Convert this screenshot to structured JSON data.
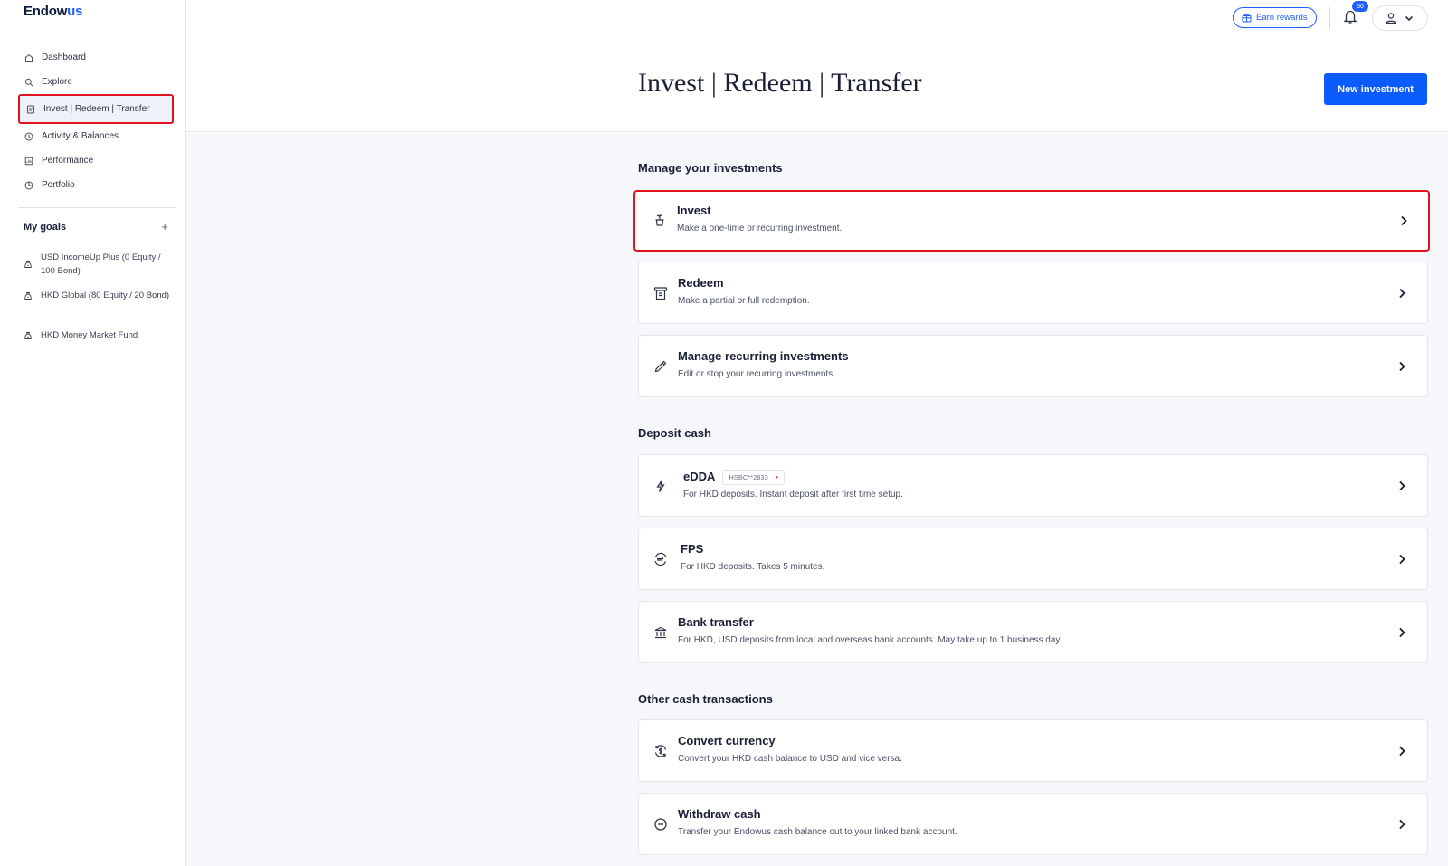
{
  "sidebar": {
    "logo_main": "Endow",
    "logo_accent": "us",
    "nav": [
      {
        "label": "Dashboard",
        "icon": "home-icon"
      },
      {
        "label": "Explore",
        "icon": "search-icon"
      },
      {
        "label": "Invest | Redeem | Transfer",
        "icon": "document-icon",
        "active": true
      },
      {
        "label": "Activity & Balances",
        "icon": "clock-icon"
      },
      {
        "label": "Performance",
        "icon": "chart-icon"
      },
      {
        "label": "Portfolio",
        "icon": "pie-icon"
      }
    ],
    "goals_title": "My goals",
    "goals_add": "+",
    "goals": [
      {
        "label": "USD IncomeUp Plus (0 Equity / 100 Bond)"
      },
      {
        "label": "HKD Global (80 Equity / 20 Bond)"
      },
      {
        "label": "HKD Money Market Fund"
      }
    ]
  },
  "header": {
    "earn_rewards": "Earn rewards",
    "notification_count": "50",
    "title": "Invest | Redeem | Transfer",
    "new_investment": "New investment"
  },
  "sections": {
    "manage": {
      "title": "Manage your investments",
      "cards": [
        {
          "title": "Invest",
          "desc": "Make a one-time or recurring investment.",
          "icon": "plant-pot-icon"
        },
        {
          "title": "Redeem",
          "desc": "Make a partial or full redemption.",
          "icon": "receipt-icon"
        },
        {
          "title": "Manage recurring investments",
          "desc": "Edit or stop your recurring investments.",
          "icon": "pencil-icon"
        }
      ]
    },
    "deposit": {
      "title": "Deposit cash",
      "cards": [
        {
          "title": "eDDA",
          "tag": "HSBC**2833",
          "desc": "For HKD deposits. Instant deposit after first time setup.",
          "icon": "lightning-icon"
        },
        {
          "title": "FPS",
          "desc": "For HKD deposits. Takes 5 minutes.",
          "icon": "fps-icon"
        },
        {
          "title": "Bank transfer",
          "desc": "For HKD, USD deposits from local and overseas bank accounts. May take up to 1 business day.",
          "icon": "bank-icon"
        }
      ]
    },
    "other": {
      "title": "Other cash transactions",
      "cards": [
        {
          "title": "Convert currency",
          "desc": "Convert your HKD cash balance to USD and vice versa.",
          "icon": "currency-exchange-icon"
        },
        {
          "title": "Withdraw cash",
          "desc": "Transfer your Endowus cash balance out to your linked bank account.",
          "icon": "minus-circle-icon"
        }
      ]
    }
  },
  "colors": {
    "brand_blue": "#0a5cff",
    "highlight_red": "#e0141e",
    "background": "#f5f7fa"
  }
}
